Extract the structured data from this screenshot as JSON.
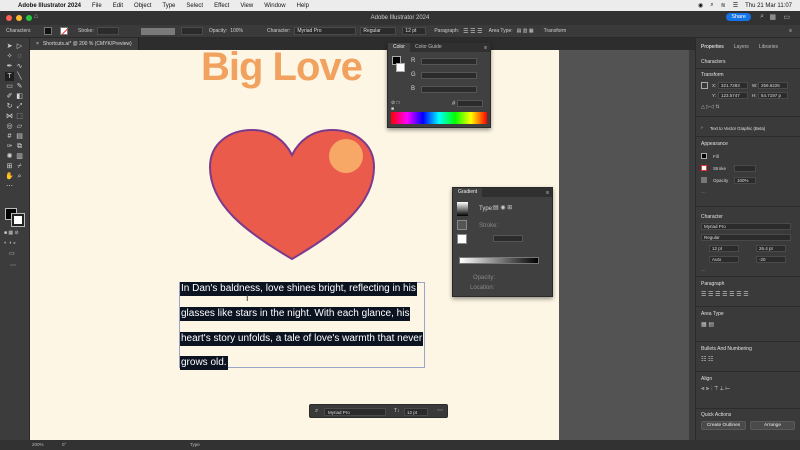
{
  "menubar": {
    "app_name": "Adobe Illustrator 2024",
    "items": [
      "File",
      "Edit",
      "Object",
      "Type",
      "Select",
      "Effect",
      "View",
      "Window",
      "Help"
    ],
    "datetime": "Thu 21 Mar  11:07"
  },
  "window": {
    "title": "Adobe Illustrator 2024",
    "share_label": "Share"
  },
  "controlbar": {
    "context": "Characters",
    "stroke_label": "Stroke:",
    "opacity_label": "Opacity:",
    "opacity_value": "100%",
    "character_label": "Character:",
    "font_family": "Myriad Pro",
    "font_style": "Regular",
    "font_size": "12 pt",
    "paragraph_label": "Paragraph:",
    "area_type_label": "Area Type:",
    "transform_label": "Transform"
  },
  "document_tab": {
    "label": "Shortcuts.ai* @ 200 % (CMYK/Preview)"
  },
  "artboard": {
    "title": "Big Love",
    "paragraph_lines": [
      "In Dan's baldness, love shines bright, reflecting in his",
      "glasses like stars in the night. With each glance, his",
      "heart's story unfolds, a tale of love's warmth that never",
      "grows old."
    ],
    "colors": {
      "background": "#fdf6e4",
      "title": "#f1a25f",
      "heart_fill": "#ea5b4c",
      "heart_stroke": "#7b3a8c",
      "highlight": "#f7a866",
      "selection": "#0b1220"
    }
  },
  "color_panel": {
    "tabs": [
      "Color",
      "Color Guide"
    ],
    "channels": [
      "R",
      "G",
      "B"
    ],
    "hex_label": "#"
  },
  "gradient_panel": {
    "title": "Gradient",
    "type_label": "Type:",
    "stroke_label": "Stroke:",
    "opacity_label": "Opacity:",
    "location_label": "Location:"
  },
  "properties_panel": {
    "tabs": [
      "Properties",
      "Layers",
      "Libraries"
    ],
    "context": "Characters",
    "transform": {
      "heading": "Transform",
      "x": "321.7283",
      "y": "123.5747",
      "w": "259.6226",
      "h": "54.7197 p"
    },
    "text_to_vector": "Text to Vector Graphic (Beta)",
    "appearance": {
      "heading": "Appearance",
      "fill_label": "Fill",
      "stroke_label": "Stroke",
      "opacity_label": "Opacity",
      "opacity_value": "100%"
    },
    "character": {
      "heading": "Character",
      "font": "Myriad Pro",
      "style": "Regular",
      "size": "12 pt",
      "leading": "26.4 pt",
      "kerning": "Auto",
      "tracking": "-20"
    },
    "paragraph_heading": "Paragraph",
    "area_type_heading": "Area Type",
    "bullets_heading": "Bullets And Numbering",
    "align_heading": "Align",
    "quick_actions": {
      "heading": "Quick Actions",
      "create_outlines": "Create Outlines",
      "arrange": "Arrange"
    }
  },
  "floating_bar": {
    "font": "Myriad Pro",
    "size": "12 pt"
  },
  "statusbar": {
    "zoom": "200%",
    "rotation": "0°",
    "tool": "Type"
  }
}
